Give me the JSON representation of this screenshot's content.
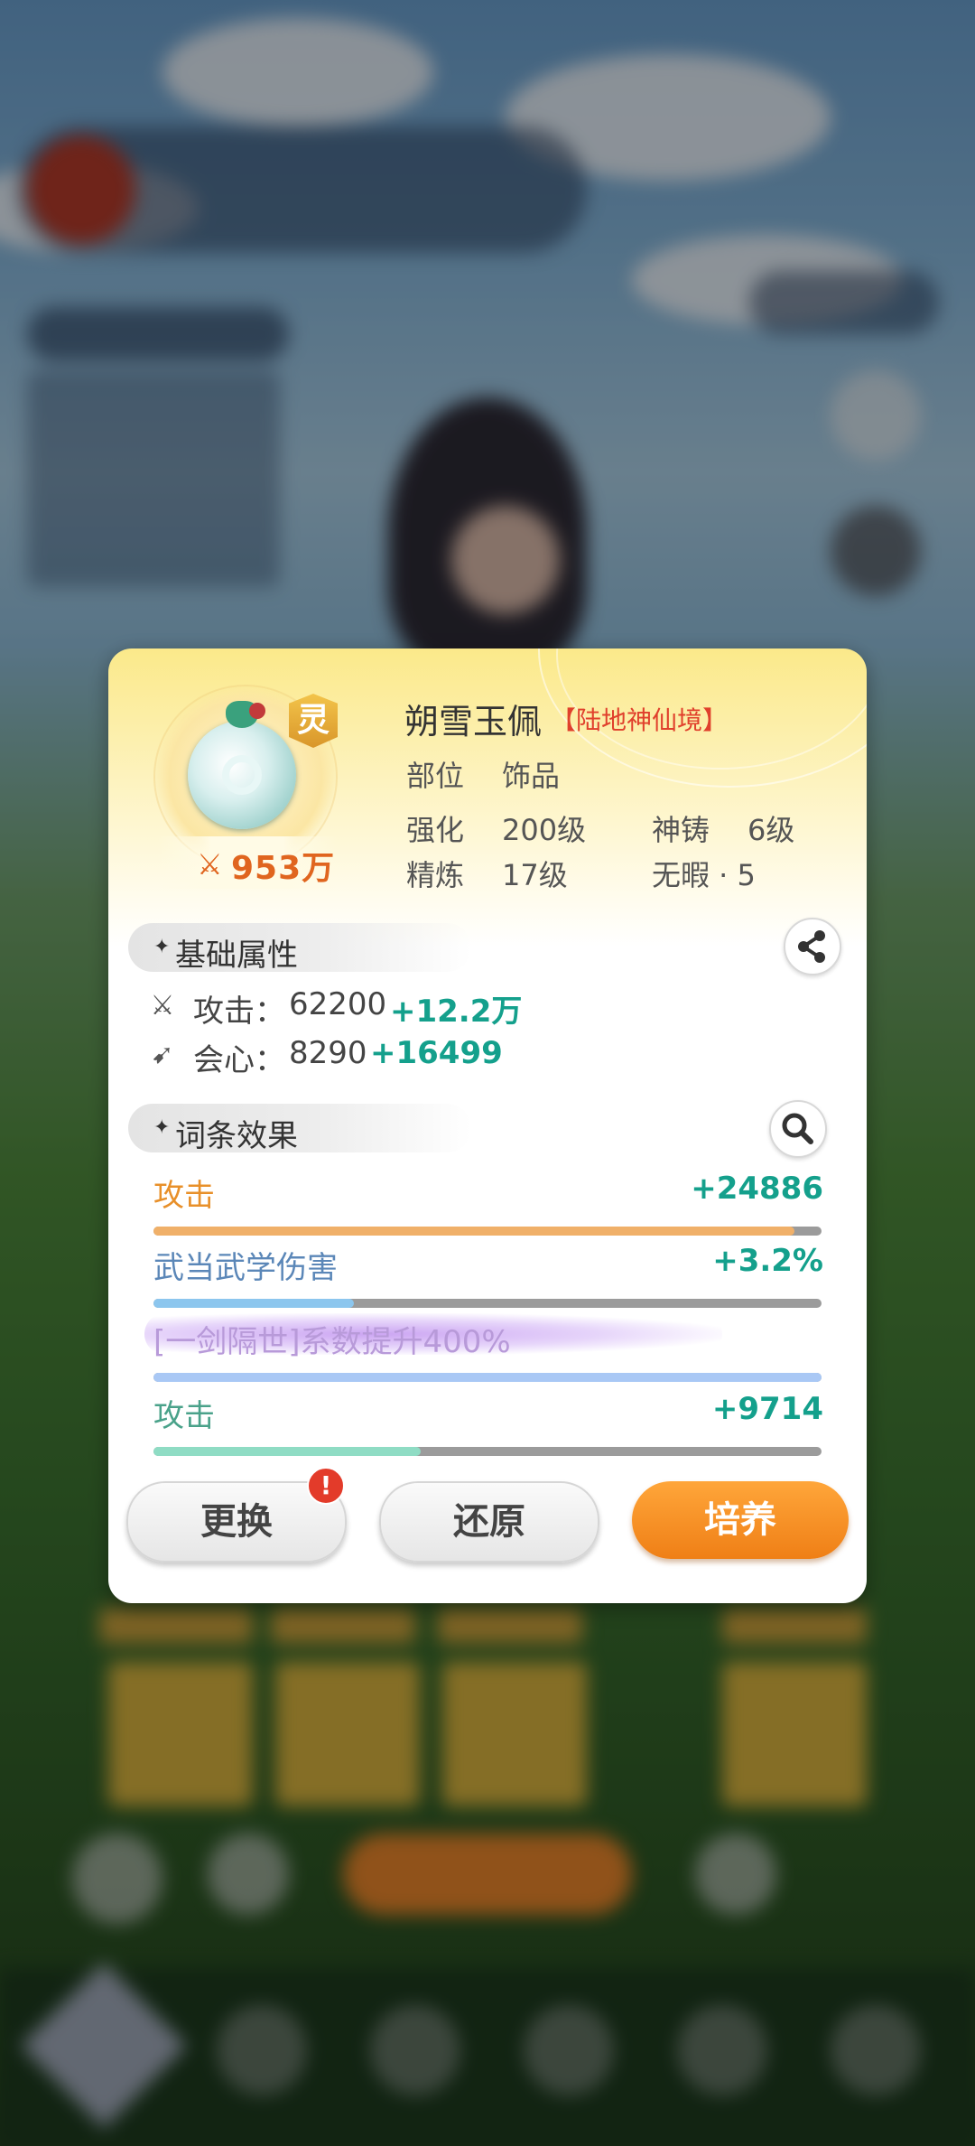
{
  "item": {
    "name": "朔雪玉佩",
    "realm": "【陆地神仙境】",
    "grade_mark": "灵",
    "power_value": "953万",
    "slot_label": "部位",
    "slot_value": "饰品",
    "enhance_label": "强化",
    "enhance_value": "200级",
    "forge_label": "神铸",
    "forge_value": "6级",
    "refine_label": "精炼",
    "refine_value": "17级",
    "flawless_label": "无暇 · 5"
  },
  "base_section": {
    "title": "基础属性",
    "attrs": [
      {
        "icon": "sword-icon",
        "label": "攻击：",
        "value": "62200",
        "bonus": "+12.2万"
      },
      {
        "icon": "crit-icon",
        "label": "会心：",
        "value": "8290",
        "bonus": "+16499"
      }
    ]
  },
  "affix_section": {
    "title": "词条效果",
    "affixes": [
      {
        "name": "攻击",
        "value": "+24886",
        "fill": 0.96,
        "name_color": "#e8902a",
        "value_color": "#14a08c",
        "bar_color": "#f0b069"
      },
      {
        "name": "武当武学伤害",
        "value": "+3.2%",
        "fill": 0.3,
        "name_color": "#5b87b8",
        "value_color": "#14a08c",
        "bar_color": "#8cc6ee"
      },
      {
        "name": "[一剑隔世]系数提升400%",
        "value": "",
        "fill": 1.0,
        "name_color": "#b89ad9",
        "value_color": "#14a08c",
        "bar_color": "#a9c8f5"
      },
      {
        "name": "攻击",
        "value": "+9714",
        "fill": 0.4,
        "name_color": "#4aa28a",
        "value_color": "#14a08c",
        "bar_color": "#8fdcc4"
      }
    ]
  },
  "buttons": {
    "replace": "更换",
    "restore": "还原",
    "cultivate": "培养",
    "badge": "!"
  },
  "colors": {
    "accent_orange": "#ef7f16",
    "bonus_green": "#14a08c"
  }
}
